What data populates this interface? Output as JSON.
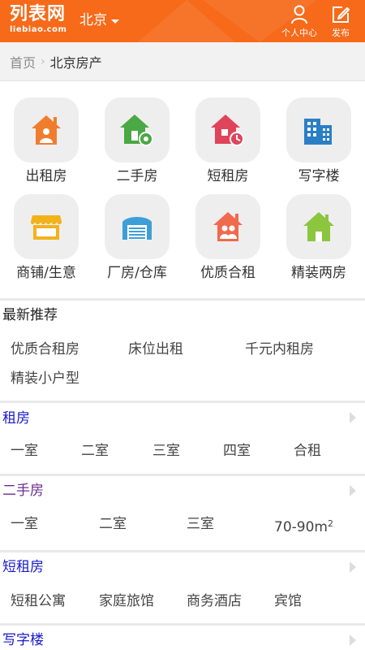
{
  "header": {
    "logo_cn": "列表网",
    "logo_en": "liebiao.com",
    "city": "北京",
    "user_center_label": "个人中心",
    "post_label": "发布"
  },
  "breadcrumb": {
    "home": "首页",
    "current": "北京房产"
  },
  "categories": [
    {
      "label": "出租房",
      "icon": "house-person-icon"
    },
    {
      "label": "二手房",
      "icon": "house-circle-icon"
    },
    {
      "label": "短租房",
      "icon": "house-clock-icon"
    },
    {
      "label": "写字楼",
      "icon": "office-building-icon"
    },
    {
      "label": "商铺/生意",
      "icon": "storefront-icon"
    },
    {
      "label": "厂房/仓库",
      "icon": "warehouse-icon"
    },
    {
      "label": "优质合租",
      "icon": "house-people-icon"
    },
    {
      "label": "精装两房",
      "icon": "green-house-icon"
    }
  ],
  "recommend": {
    "title": "最新推荐",
    "links": [
      "优质合租房",
      "床位出租",
      "千元内租房",
      "精装小户型"
    ]
  },
  "sections": {
    "rent": {
      "title": "租房",
      "links": [
        "一室",
        "二室",
        "三室",
        "四室",
        "合租"
      ]
    },
    "secondhand": {
      "title": "二手房",
      "links": [
        "一室",
        "二室",
        "三室"
      ],
      "area_value": "70-90m",
      "area_sup": "2"
    },
    "shortrent": {
      "title": "短租房",
      "links": [
        "短租公寓",
        "家庭旅馆",
        "商务酒店",
        "宾馆"
      ]
    },
    "office": {
      "title": "写字楼"
    }
  },
  "colors": {
    "brand_orange": "#f66a1a",
    "link_blue": "#1a1acc",
    "visited_purple": "#6b2d8f"
  }
}
